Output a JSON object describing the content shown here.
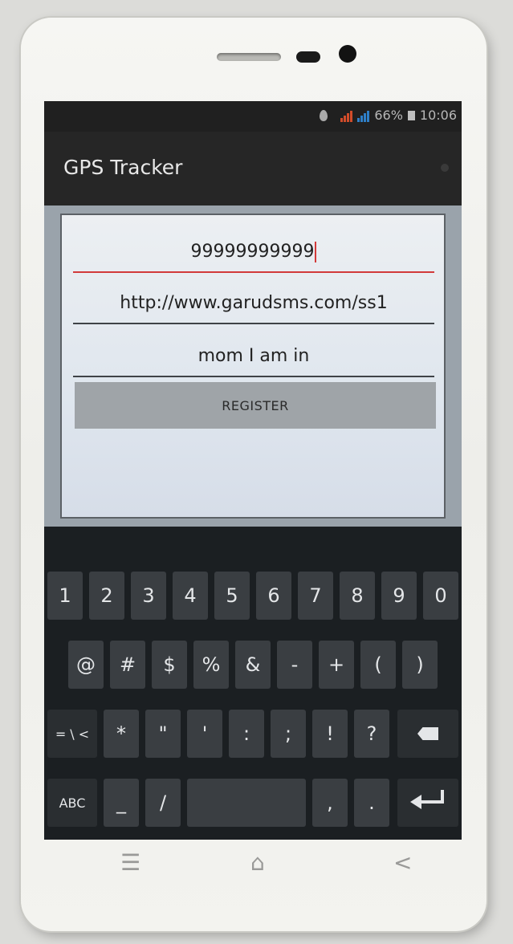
{
  "status_bar": {
    "battery_percent": "66%",
    "time": "10:06"
  },
  "action_bar": {
    "title": "GPS Tracker"
  },
  "form": {
    "phone_value": "99999999999",
    "url_value": "http://www.garudsms.com/ss1",
    "message_value": "mom I am in",
    "register_label": "REGISTER"
  },
  "keyboard": {
    "row1": [
      "1",
      "2",
      "3",
      "4",
      "5",
      "6",
      "7",
      "8",
      "9",
      "0"
    ],
    "row2": [
      "@",
      "#",
      "$",
      "%",
      "&",
      "-",
      "+",
      "(",
      ")"
    ],
    "row3": [
      "= \\ <",
      "*",
      "\"",
      "'",
      ":",
      ";",
      "!",
      "?"
    ],
    "row4": {
      "abc": "ABC",
      "underscore": "_",
      "slash": "/",
      "comma": ",",
      "period": "."
    }
  },
  "nav": {
    "menu": "☰",
    "home": "⌂",
    "back": "<"
  }
}
